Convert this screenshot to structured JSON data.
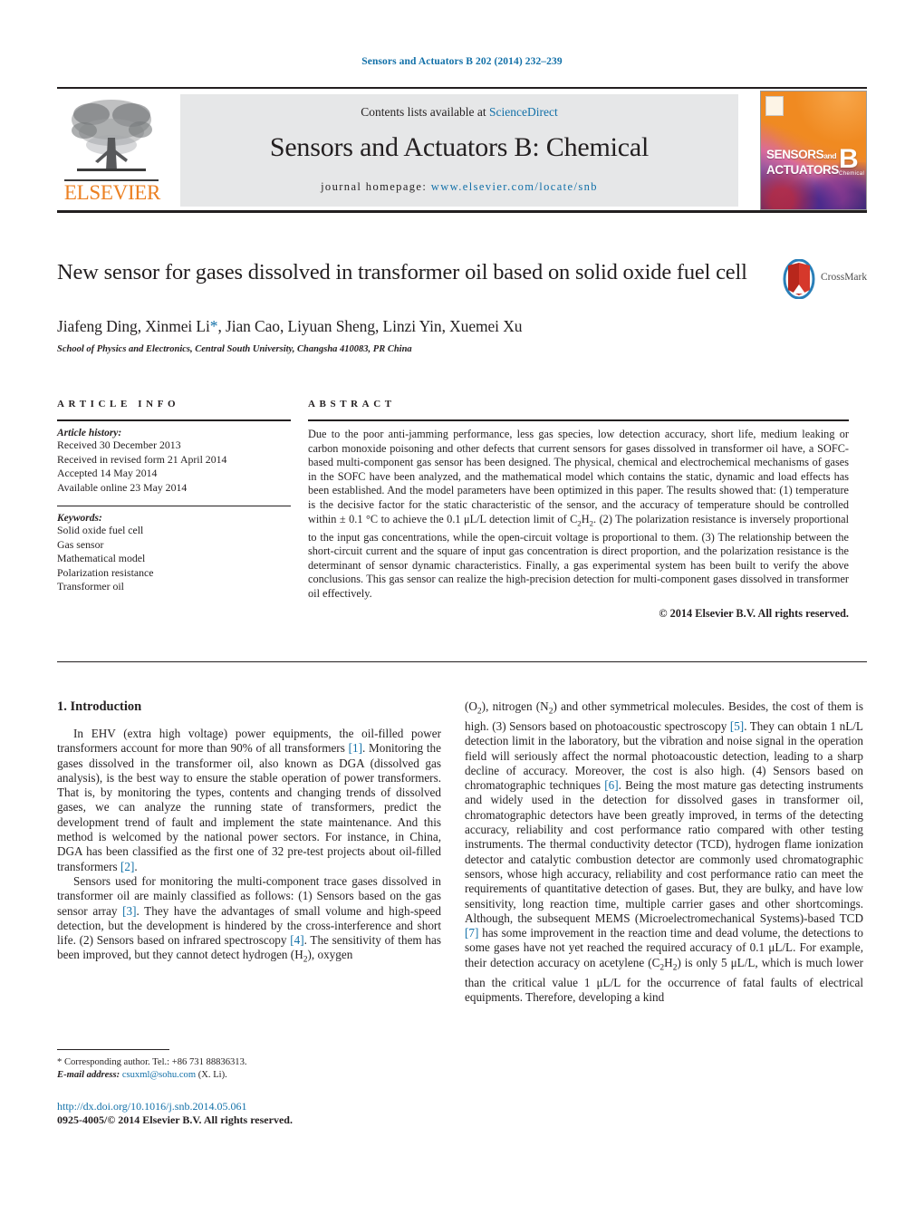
{
  "running_head": "Sensors and Actuators B 202 (2014) 232–239",
  "masthead": {
    "publisher": "ELSEVIER",
    "contents_prefix": "Contents lists available at ",
    "contents_link": "ScienceDirect",
    "journal_title": "Sensors and Actuators B: Chemical",
    "homepage_prefix": "journal homepage:",
    "homepage_url": "www.elsevier.com/locate/snb",
    "cover": {
      "line1": "SENSORS",
      "line1_small": "and",
      "line2": "ACTUATORS",
      "volume_letter": "B",
      "volume_sub": "Chemical"
    }
  },
  "article": {
    "title": "New sensor for gases dissolved in transformer oil based on solid oxide fuel cell",
    "authors": "Jiafeng Ding, Xinmei Li",
    "author_star": "*",
    "authors_rest": ", Jian Cao, Liyuan Sheng, Linzi Yin, Xuemei Xu",
    "affiliation": "School of Physics and Electronics, Central South University, Changsha 410083, PR China",
    "crossmark_label": "CrossMark"
  },
  "article_info": {
    "heading": "ARTICLE INFO",
    "history_label": "Article history:",
    "history": [
      "Received 30 December 2013",
      "Received in revised form 21 April 2014",
      "Accepted 14 May 2014",
      "Available online 23 May 2014"
    ],
    "keywords_label": "Keywords:",
    "keywords": [
      "Solid oxide fuel cell",
      "Gas sensor",
      "Mathematical model",
      "Polarization resistance",
      "Transformer oil"
    ]
  },
  "abstract": {
    "heading": "ABSTRACT",
    "text": "Due to the poor anti-jamming performance, less gas species, low detection accuracy, short life, medium leaking or carbon monoxide poisoning and other defects that current sensors for gases dissolved in transformer oil have, a SOFC-based multi-component gas sensor has been designed. The physical, chemical and electrochemical mechanisms of gases in the SOFC have been analyzed, and the mathematical model which contains the static, dynamic and load effects has been established. And the model parameters have been optimized in this paper. The results showed that: (1) temperature is the decisive factor for the static characteristic of the sensor, and the accuracy of temperature should be controlled within ± 0.1 °C to achieve the 0.1 μL/L detection limit of C2H2. (2) The polarization resistance is inversely proportional to the input gas concentrations, while the open-circuit voltage is proportional to them. (3) The relationship between the short-circuit current and the square of input gas concentration is direct proportion, and the polarization resistance is the determinant of sensor dynamic characteristics. Finally, a gas experimental system has been built to verify the above conclusions. This gas sensor can realize the high-precision detection for multi-component gases dissolved in transformer oil effectively.",
    "copyright": "© 2014 Elsevier B.V. All rights reserved."
  },
  "body": {
    "section_number": "1.",
    "section_title": "Introduction",
    "left_paragraph_1": "In EHV (extra high voltage) power equipments, the oil-filled power transformers account for more than 90% of all transformers [1]. Monitoring the gases dissolved in the transformer oil, also known as DGA (dissolved gas analysis), is the best way to ensure the stable operation of power transformers. That is, by monitoring the types, contents and changing trends of dissolved gases, we can analyze the running state of transformers, predict the development trend of fault and implement the state maintenance. And this method is welcomed by the national power sectors. For instance, in China, DGA has been classified as the first one of 32 pre-test projects about oil-filled transformers [2].",
    "left_paragraph_2": "Sensors used for monitoring the multi-component trace gases dissolved in transformer oil are mainly classified as follows: (1) Sensors based on the gas sensor array [3]. They have the advantages of small volume and high-speed detection, but the development is hindered by the cross-interference and short life. (2) Sensors based on infrared spectroscopy [4]. The sensitivity of them has been improved, but they cannot detect hydrogen (H2), oxygen",
    "right_paragraph_1": "(O2), nitrogen (N2) and other symmetrical molecules. Besides, the cost of them is high. (3) Sensors based on photoacoustic spectroscopy [5]. They can obtain 1 nL/L detection limit in the laboratory, but the vibration and noise signal in the operation field will seriously affect the normal photoacoustic detection, leading to a sharp decline of accuracy. Moreover, the cost is also high. (4) Sensors based on chromatographic techniques [6]. Being the most mature gas detecting instruments and widely used in the detection for dissolved gases in transformer oil, chromatographic detectors have been greatly improved, in terms of the detecting accuracy, reliability and cost performance ratio compared with other testing instruments. The thermal conductivity detector (TCD), hydrogen flame ionization detector and catalytic combustion detector are commonly used chromatographic sensors, whose high accuracy, reliability and cost performance ratio can meet the requirements of quantitative detection of gases. But, they are bulky, and have low sensitivity, long reaction time, multiple carrier gases and other shortcomings. Although, the subsequent MEMS (Microelectromechanical Systems)-based TCD [7] has some improvement in the reaction time and dead volume, the detections to some gases have not yet reached the required accuracy of 0.1 μL/L. For example, their detection accuracy on acetylene (C2H2) is only 5 μL/L, which is much lower than the critical value 1 μL/L for the occurrence of fatal faults of electrical equipments. Therefore, developing a kind"
  },
  "footnote": {
    "corresponding": "* Corresponding author. Tel.: +86 731 88836313.",
    "email_label": "E-mail address:",
    "email": "csuxml@sohu.com",
    "email_owner": "(X. Li)."
  },
  "footer": {
    "doi": "http://dx.doi.org/10.1016/j.snb.2014.05.061",
    "issn": "0925-4005/© 2014 Elsevier B.V. All rights reserved."
  },
  "colors": {
    "link_blue": "#1270a8",
    "elsevier_orange": "#ec8022",
    "band_grey": "#e6e7e8",
    "text_black": "#231f20"
  }
}
